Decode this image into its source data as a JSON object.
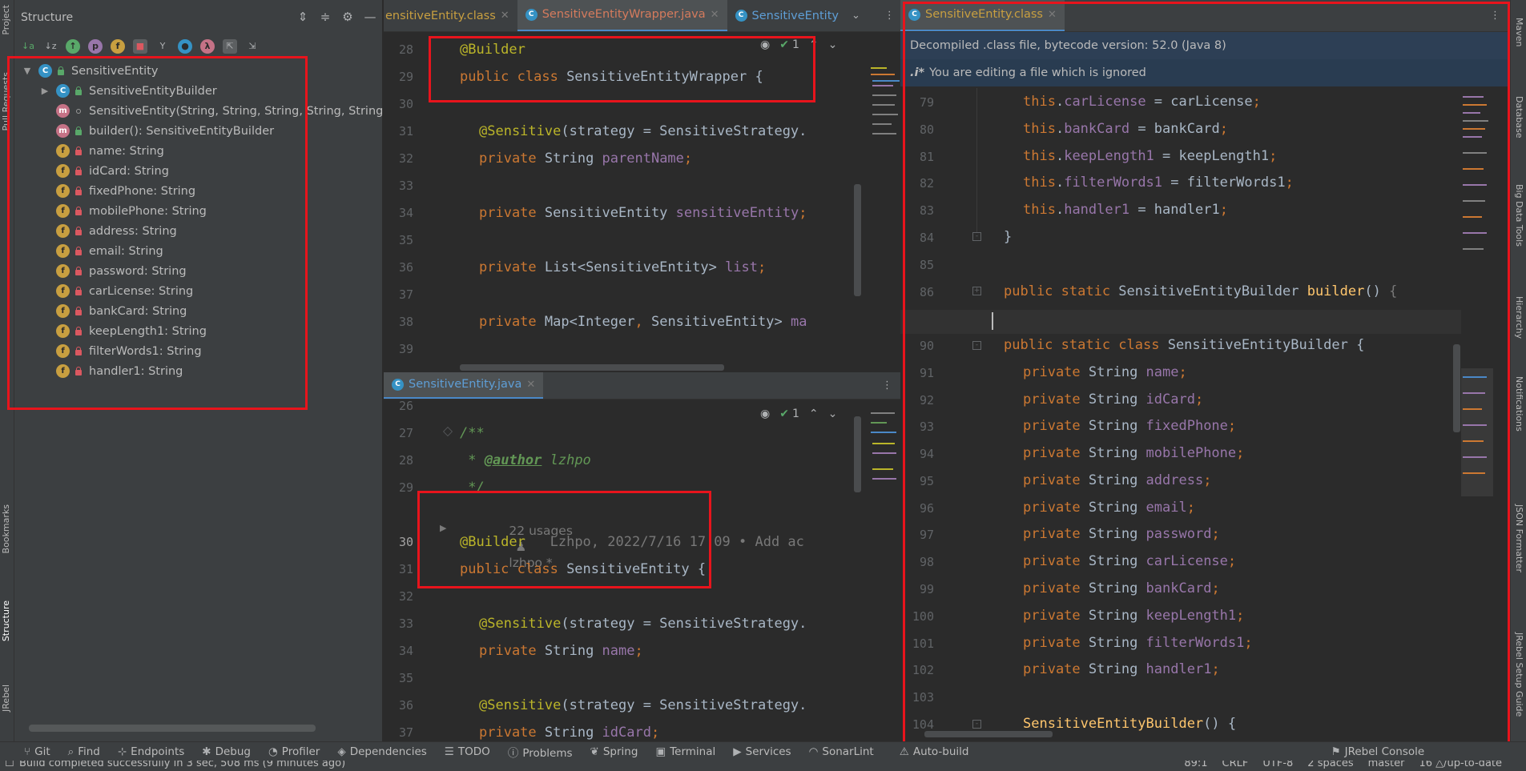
{
  "left_strip": {
    "project": "Project",
    "pull_requests": "Pull Requests",
    "bookmarks": "Bookmarks",
    "structure": "Structure",
    "jrebel": "JRebel"
  },
  "structure": {
    "title": "Structure",
    "tree": [
      {
        "label": "SensitiveEntity",
        "icon": "class-icon"
      },
      {
        "label": "SensitiveEntityBuilder",
        "icon": "class-icon"
      },
      {
        "label": "SensitiveEntity(String, String, String, String, String",
        "icon": "method-icon"
      },
      {
        "label": "builder(): SensitiveEntityBuilder",
        "icon": "method-icon"
      },
      {
        "label": "name: String",
        "icon": "field-icon"
      },
      {
        "label": "idCard: String",
        "icon": "field-icon"
      },
      {
        "label": "fixedPhone: String",
        "icon": "field-icon"
      },
      {
        "label": "mobilePhone: String",
        "icon": "field-icon"
      },
      {
        "label": "address: String",
        "icon": "field-icon"
      },
      {
        "label": "email: String",
        "icon": "field-icon"
      },
      {
        "label": "password: String",
        "icon": "field-icon"
      },
      {
        "label": "carLicense: String",
        "icon": "field-icon"
      },
      {
        "label": "bankCard: String",
        "icon": "field-icon"
      },
      {
        "label": "keepLength1: String",
        "icon": "field-icon"
      },
      {
        "label": "filterWords1: String",
        "icon": "field-icon"
      },
      {
        "label": "handler1: String",
        "icon": "field-icon"
      }
    ]
  },
  "editor_top": {
    "tabs": [
      "ensitiveEntity.class",
      "SensitiveEntityWrapper.java",
      "SensitiveEntity"
    ],
    "inspection_count": "1",
    "line_numbers": [
      "28",
      "29",
      "30",
      "31",
      "32",
      "33",
      "34",
      "35",
      "36",
      "37",
      "38",
      "39"
    ]
  },
  "editor_bottom": {
    "tab": "SensitiveEntity.java",
    "inspection_count": "1",
    "line_numbers": [
      "26",
      "27",
      "28",
      "29",
      "30",
      "31",
      "32",
      "33",
      "34",
      "35",
      "36",
      "37"
    ],
    "usages": "22 usages",
    "author_hint": "lzhpo *",
    "inline_blame": "Lzhpo, 2022/7/16 17:09 • Add ac"
  },
  "editor_right": {
    "tab": "SensitiveEntity.class",
    "banner1": "Decompiled .class file, bytecode version: 52.0 (Java 8)",
    "banner2": "You are editing a file which is ignored",
    "banner2_icon": ".i*",
    "line_numbers": [
      "79",
      "80",
      "81",
      "82",
      "83",
      "84",
      "85",
      "86",
      "89",
      "90",
      "91",
      "92",
      "93",
      "94",
      "95",
      "96",
      "97",
      "98",
      "99",
      "100",
      "101",
      "102",
      "103",
      "104"
    ],
    "ctor_assignments": [
      "carLicense",
      "bankCard",
      "keepLength1",
      "filterWords1",
      "handler1"
    ],
    "builder_fields": [
      "name",
      "idCard",
      "fixedPhone",
      "mobilePhone",
      "address",
      "email",
      "password",
      "carLicense",
      "bankCard",
      "keepLength1",
      "filterWords1",
      "handler1"
    ]
  },
  "right_strip": {
    "maven": "Maven",
    "database": "Database",
    "big_data_tools": "Big Data Tools",
    "hierarchy": "Hierarchy",
    "notifications": "Notifications",
    "json_formatter": "JSON Formatter",
    "jrebel_setup_guide": "JRebel Setup Guide"
  },
  "toolwindows": [
    "Git",
    "Find",
    "Endpoints",
    "Debug",
    "Profiler",
    "Dependencies",
    "TODO",
    "Problems",
    "Spring",
    "Terminal",
    "Services",
    "SonarLint",
    "Auto-build",
    "JRebel Console"
  ],
  "status": {
    "message": "Build completed successfully in 3 sec, 508 ms (9 minutes ago)",
    "position": "89:1",
    "line_sep": "CRLF",
    "encoding": "UTF-8",
    "indent": "2 spaces",
    "branch": "master",
    "vcs": "16 △/up-to-date"
  },
  "colors": {
    "accent": "#4a88c7",
    "highlight": "#e8141c",
    "keyword": "#cc7832",
    "annotation": "#bbb529",
    "field": "#9876aa"
  }
}
